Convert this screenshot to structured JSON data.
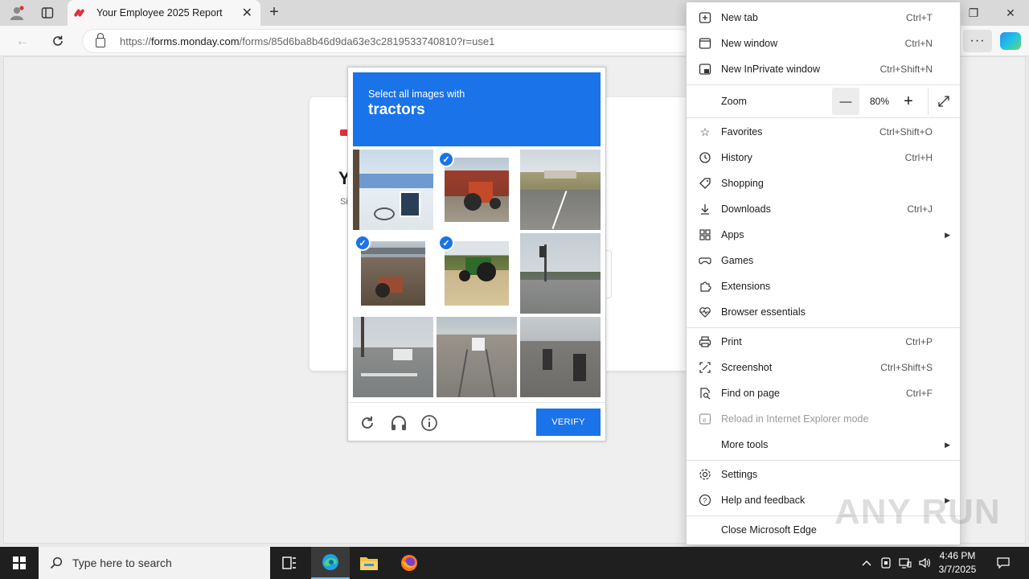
{
  "browser": {
    "tab_title": "Your Employee 2025 Report",
    "url_prefix": "https://",
    "url_domain": "forms.monday.com",
    "url_path": "/forms/85d6ba8b46d9da63e3c2819533740810?r=use1"
  },
  "form": {
    "title_initial": "Y",
    "subtitle_initial": "Si"
  },
  "captcha": {
    "instruction": "Select all images with",
    "target": "tractors",
    "verify_label": "VERIFY",
    "tiles": [
      {
        "desc": "storefront-bicycle",
        "selected": false
      },
      {
        "desc": "red-tractor-barn",
        "selected": true
      },
      {
        "desc": "road-overpass",
        "selected": false
      },
      {
        "desc": "tractor-under-bridge",
        "selected": true
      },
      {
        "desc": "green-tractor-field",
        "selected": true
      },
      {
        "desc": "street-intersection",
        "selected": false
      },
      {
        "desc": "street-crosswalk",
        "selected": false
      },
      {
        "desc": "tram-street",
        "selected": false
      },
      {
        "desc": "motorcycles-street",
        "selected": false
      }
    ]
  },
  "menu": {
    "new_tab": {
      "label": "New tab",
      "shortcut": "Ctrl+T"
    },
    "new_window": {
      "label": "New window",
      "shortcut": "Ctrl+N"
    },
    "new_inprivate": {
      "label": "New InPrivate window",
      "shortcut": "Ctrl+Shift+N"
    },
    "zoom": {
      "label": "Zoom",
      "value": "80%",
      "minus": "—",
      "plus": "+"
    },
    "favorites": {
      "label": "Favorites",
      "shortcut": "Ctrl+Shift+O"
    },
    "history": {
      "label": "History",
      "shortcut": "Ctrl+H"
    },
    "shopping": {
      "label": "Shopping"
    },
    "downloads": {
      "label": "Downloads",
      "shortcut": "Ctrl+J"
    },
    "apps": {
      "label": "Apps"
    },
    "games": {
      "label": "Games"
    },
    "extensions": {
      "label": "Extensions"
    },
    "browser_essentials": {
      "label": "Browser essentials"
    },
    "print": {
      "label": "Print",
      "shortcut": "Ctrl+P"
    },
    "screenshot": {
      "label": "Screenshot",
      "shortcut": "Ctrl+Shift+S"
    },
    "find": {
      "label": "Find on page",
      "shortcut": "Ctrl+F"
    },
    "ie_mode": {
      "label": "Reload in Internet Explorer mode"
    },
    "more_tools": {
      "label": "More tools"
    },
    "settings": {
      "label": "Settings"
    },
    "help": {
      "label": "Help and feedback"
    },
    "close": {
      "label": "Close Microsoft Edge"
    }
  },
  "taskbar": {
    "search_placeholder": "Type here to search",
    "time": "4:46 PM",
    "date": "3/7/2025"
  },
  "watermark": "ANY RUN",
  "colors": {
    "accent": "#1a73e8",
    "menu_bg": "#ffffff",
    "taskbar": "#1f1f1f"
  }
}
